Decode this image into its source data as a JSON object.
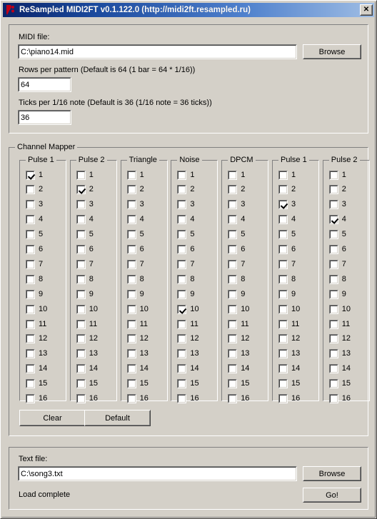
{
  "window": {
    "title": "ReSampled MIDI2FT v0.1.122.0 (http://midi2ft.resampled.ru)",
    "icon": "app-icon",
    "close_label": "✕"
  },
  "settings": {
    "midi_file_label": "MIDI file:",
    "midi_file_value": "C:\\piano14.mid",
    "midi_browse_label": "Browse",
    "rows_per_pattern_label": "Rows per pattern (Default is 64 (1 bar = 64 * 1/16))",
    "rows_per_pattern_value": "64",
    "ticks_label": "Ticks per 1/16 note (Default is 36 (1/16 note = 36 ticks))",
    "ticks_value": "36"
  },
  "channel_mapper": {
    "title": "Channel Mapper",
    "clear_label": "Clear",
    "default_label": "Default",
    "channel_numbers": [
      "1",
      "2",
      "3",
      "4",
      "5",
      "6",
      "7",
      "8",
      "9",
      "10",
      "11",
      "12",
      "13",
      "14",
      "15",
      "16"
    ],
    "columns": [
      {
        "title": "Pulse 1",
        "checked": [
          1
        ]
      },
      {
        "title": "Pulse 2",
        "checked": [
          2
        ]
      },
      {
        "title": "Triangle",
        "checked": []
      },
      {
        "title": "Noise",
        "checked": [
          10
        ]
      },
      {
        "title": "DPCM",
        "checked": []
      },
      {
        "title": "Pulse 1",
        "checked": [
          3
        ]
      },
      {
        "title": "Pulse 2",
        "checked": [
          4
        ]
      }
    ]
  },
  "output": {
    "text_file_label": "Text file:",
    "text_file_value": "C:\\song3.txt",
    "text_browse_label": "Browse",
    "status": "Load complete",
    "go_label": "Go!"
  }
}
